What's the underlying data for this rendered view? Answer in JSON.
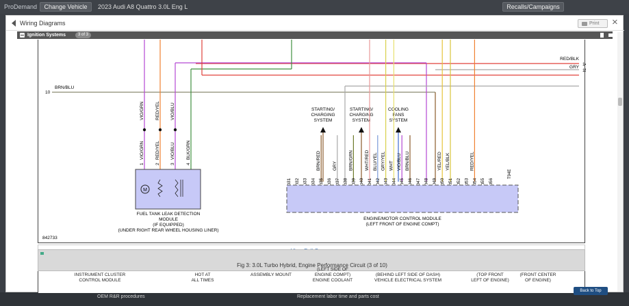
{
  "topbar": {
    "brand": "ProDemand",
    "change_vehicle": "Change Vehicle",
    "vehicle": "2023 Audi A8 Quattro 3.0L Eng L",
    "recalls": "Recalls/Campaigns"
  },
  "modal": {
    "title": "Wiring Diagrams",
    "print": "Print",
    "close": "×"
  },
  "section": {
    "title": "Ignition Systems",
    "page": "3 of 3"
  },
  "diagram": {
    "top_wires": [
      {
        "label": "RED/BLK",
        "num": "14"
      },
      {
        "label": "GRY",
        "num": "15"
      }
    ],
    "left_wire": {
      "num": "10",
      "label": "BRN/BLU"
    },
    "fuel_labels_top": [
      "VIO/GRN",
      "RED/YEL",
      "VIO/BLU"
    ],
    "fuel_pins": [
      {
        "n": "1",
        "c": "VIO/GRN"
      },
      {
        "n": "2",
        "c": "RED/YEL"
      },
      {
        "n": "3",
        "c": "VIO/BLU"
      },
      {
        "n": "4",
        "c": "BLK/GRN"
      }
    ],
    "fuel_module": [
      "FUEL TANK LEAK DETECTION",
      "MODULE",
      "(IF EQUIPPED)",
      "(UNDER RIGHT REAR WHEEL HOUSING LINER)"
    ],
    "motor_symbol": "M",
    "systems": [
      [
        "STARTING/",
        "CHARGING",
        "SYSTEM"
      ],
      [
        "STARTING/",
        "CHARGING",
        "SYSTEM"
      ],
      [
        "COOLING",
        "FANS",
        "SYSTEM"
      ]
    ],
    "ecm_wire_colors": [
      {
        "pin": "35",
        "c": "BRN/RED"
      },
      {
        "pin": "37",
        "c": "GRY"
      },
      {
        "pin": "39",
        "c": "BRN/GRN"
      },
      {
        "pin": "41",
        "c": "WHT/RED"
      },
      {
        "pin": "42",
        "c": "BLU/YEL"
      },
      {
        "pin": "43",
        "c": "GRY/YEL"
      },
      {
        "pin": "44",
        "c": "WHT"
      },
      {
        "pin": "45",
        "c": "VIO/BLU"
      },
      {
        "pin": "46",
        "c": "BRN/BLU"
      },
      {
        "pin": "50",
        "c": "YEL/RED"
      },
      {
        "pin": "51",
        "c": "YEL/BLK"
      },
      {
        "pin": "54",
        "c": "RED/YEL"
      }
    ],
    "ecm_pins": [
      "31",
      "32",
      "33",
      "34",
      "35",
      "36",
      "37",
      "38",
      "39",
      "40",
      "41",
      "42",
      "43",
      "44",
      "45",
      "46",
      "47",
      "48",
      "49",
      "50",
      "51",
      "52",
      "53",
      "54",
      "55",
      "56"
    ],
    "ecm_connector": "T94E",
    "ecm_module": [
      "ENGINE/MOTOR CONTROL MODULE",
      "(LEFT FRONT OF ENGINE COMPT)"
    ],
    "ref": "842733",
    "colors": {
      "vio": "#b448d4",
      "red": "#e0403a",
      "orange": "#f08030",
      "brn": "#8a5a2a",
      "gry": "#a8a8a8",
      "grn": "#3f8f3f",
      "yel": "#e6d43a",
      "blk": "#222222",
      "blu": "#4a74d8",
      "wht": "#dddddd",
      "module_fill": "#c7c9f7"
    }
  },
  "view_full": "View Full-Screen",
  "fig3": {
    "caption": "Fig 3: 3.0L Turbo Hybrid, Engine Performance Circuit (3 of 10)",
    "labels": [
      "INSTRUMENT CLUSTER\nCONTROL MODULE",
      "HOT AT\nALL TIMES",
      "ASSEMBLY MOUNT",
      "(LEFT SIDE OF\nENGINE COMPT)\nENGINE COOLANT",
      "(BEHIND LEFT SIDE OF DASH)\nVEHICLE ELECTRICAL SYSTEM",
      "(TOP FRONT\nLEFT OF ENGINE)",
      "(FRONT CENTER\nOF ENGINE)"
    ]
  },
  "bottom": {
    "link1": "OEM R&R procedures",
    "link2": "Replacement labor time and parts cost",
    "back_to_top": "Back to Top"
  }
}
